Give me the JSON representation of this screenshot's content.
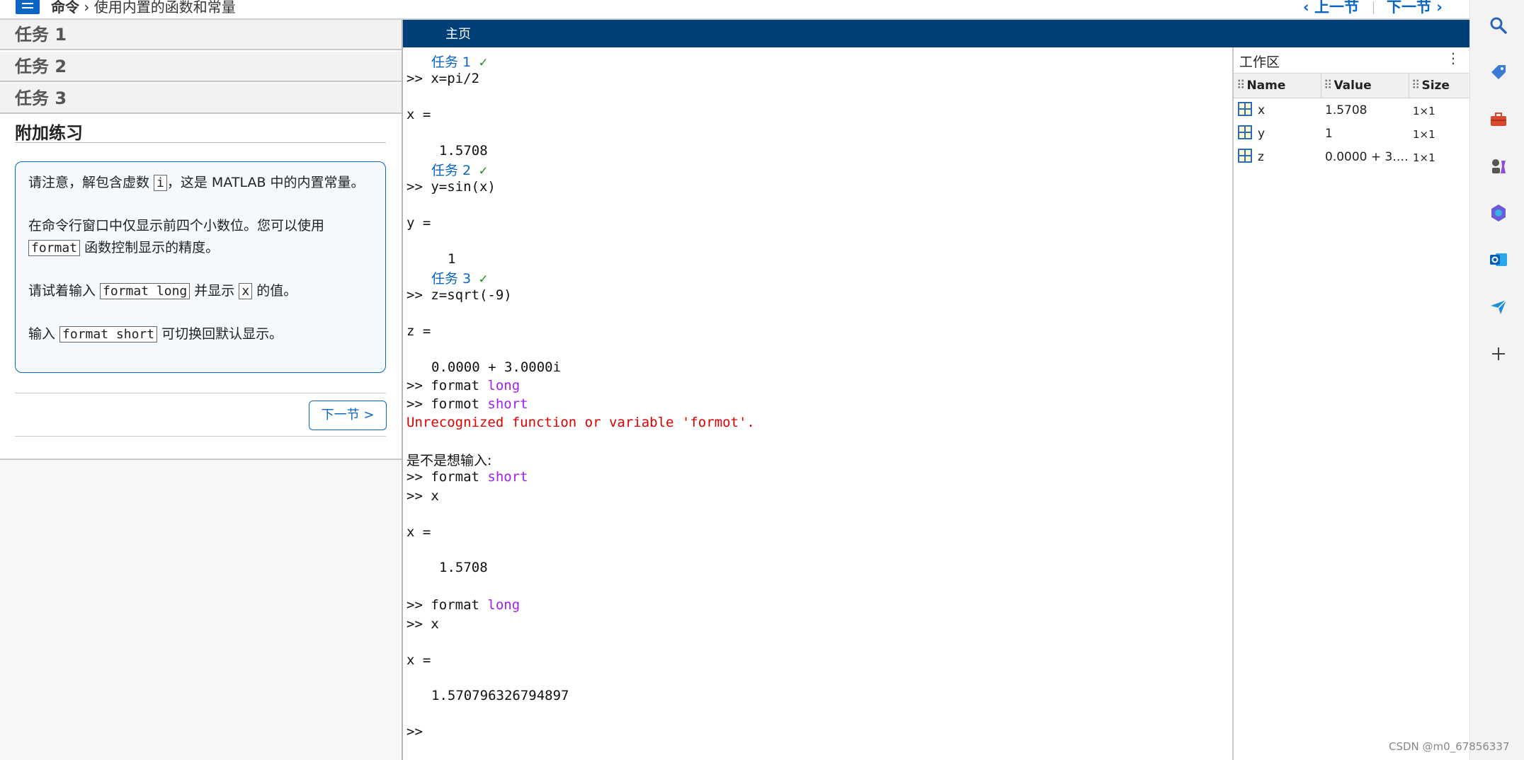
{
  "breadcrumb": {
    "section": "命令",
    "sep": "›",
    "page": "使用内置的函数和常量"
  },
  "nav": {
    "prev": "‹ 上一节",
    "next": "下一节 ›"
  },
  "tasks": [
    "任务 1",
    "任务 2",
    "任务 3"
  ],
  "extra": {
    "title": "附加练习",
    "p1_a": "请注意，解包含虚数 ",
    "p1_code": "i",
    "p1_b": "，这是 MATLAB 中的内置常量。",
    "p2_a": "在命令行窗口中仅显示前四个小数位。您可以使用 ",
    "p2_code": "format",
    "p2_b": " 函数控制显示的精度。",
    "p3_a": "请试着输入 ",
    "p3_code1": "format long",
    "p3_b": " 并显示 ",
    "p3_code2": "x",
    "p3_c": " 的值。",
    "p4_a": "输入 ",
    "p4_code": "format short",
    "p4_b": " 可切换回默认显示。",
    "next_button": "下一节 >"
  },
  "tab": {
    "label": "主页"
  },
  "console": {
    "task1": "任务 1",
    "task2": "任务 2",
    "task3": "任务 3",
    "check": "✓",
    "cmd1": ">> x=pi/2",
    "out1_name": "x =",
    "out1_val": "1.5708",
    "cmd2": ">> y=sin(x)",
    "out2_name": "y =",
    "out2_val": "1",
    "cmd3": ">> z=sqrt(-9)",
    "out3_name": "z =",
    "out3_val": "0.0000 + 3.0000i",
    "cmd4_a": ">> format ",
    "cmd4_kw": "long",
    "cmd5_a": ">> formot ",
    "cmd5_kw": "short",
    "error": "Unrecognized function or variable 'formot'.",
    "suggest": "是不是想输入:",
    "cmd6_a": ">> format ",
    "cmd6_kw": "short",
    "cmd7": ">> x",
    "out7_name": "x =",
    "out7_val": "1.5708",
    "cmd8_a": ">> format ",
    "cmd8_kw": "long",
    "cmd9": ">> x",
    "out9_name": "x =",
    "out9_val": "1.570796326794897",
    "prompt": ">>"
  },
  "workspace": {
    "title": "工作区",
    "more": "⋮",
    "columns": [
      "Name",
      "Value",
      "Size"
    ],
    "rows": [
      {
        "name": "x",
        "value": "1.5708",
        "size": "1×1"
      },
      {
        "name": "y",
        "value": "1",
        "size": "1×1"
      },
      {
        "name": "z",
        "value": "0.0000 + 3.…",
        "size": "1×1"
      }
    ]
  },
  "rail_icons": [
    "search-icon",
    "tag-icon",
    "toolbox-icon",
    "chess-icon",
    "copilot-icon",
    "outlook-icon",
    "send-icon",
    "add-icon"
  ],
  "watermark": "CSDN @m0_67856337"
}
